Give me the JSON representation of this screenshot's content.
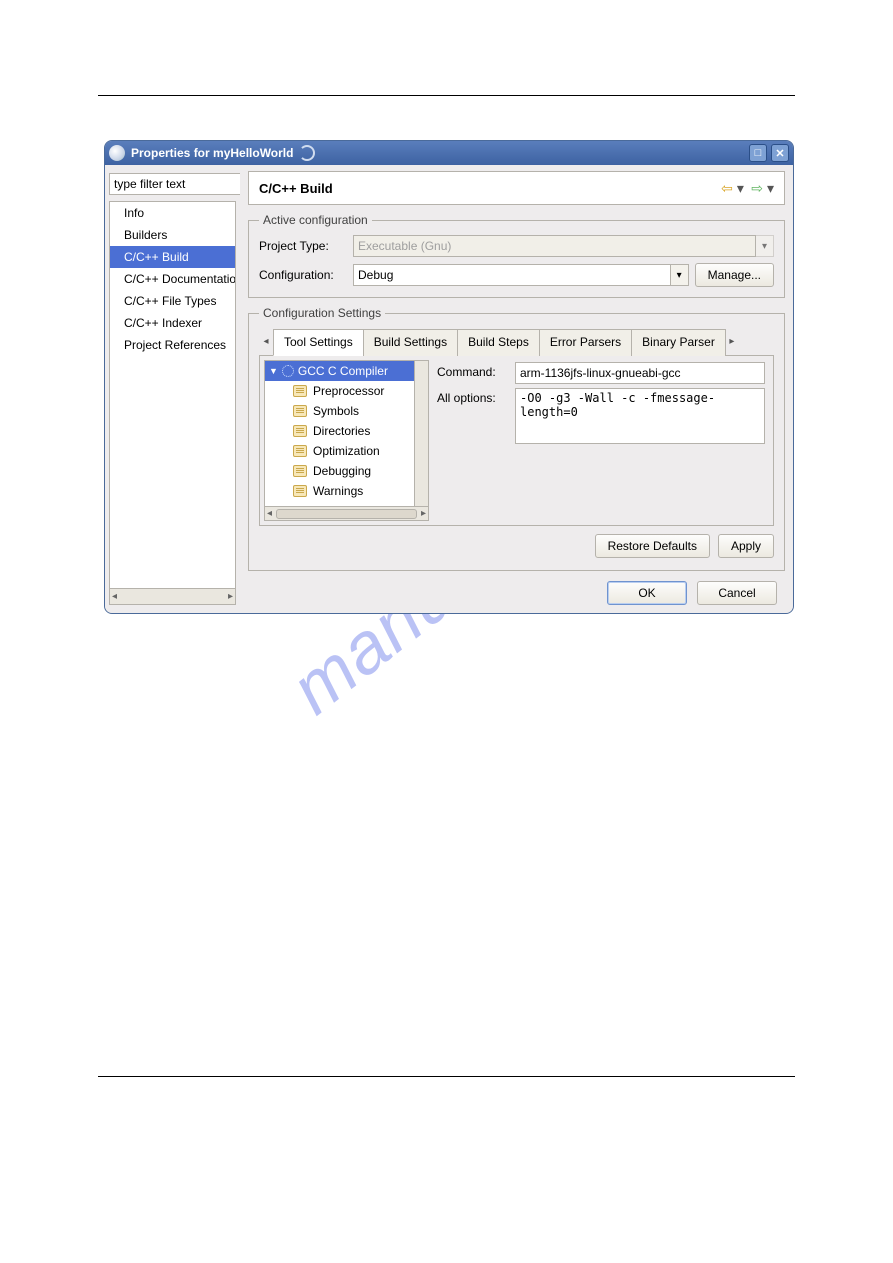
{
  "watermark": "manualshive.com",
  "titlebar": {
    "title": "Properties for myHelloWorld"
  },
  "sidebar": {
    "filter_placeholder": "type filter text",
    "items": [
      {
        "label": "Info"
      },
      {
        "label": "Builders"
      },
      {
        "label": "C/C++ Build",
        "selected": true
      },
      {
        "label": "C/C++ Documentatio"
      },
      {
        "label": "C/C++ File Types"
      },
      {
        "label": "C/C++ Indexer"
      },
      {
        "label": "Project References"
      }
    ]
  },
  "main": {
    "title": "C/C++ Build",
    "active_config": {
      "legend": "Active configuration",
      "project_type_label": "Project Type:",
      "project_type_value": "Executable (Gnu)",
      "configuration_label": "Configuration:",
      "configuration_value": "Debug",
      "manage_label": "Manage..."
    },
    "config_settings": {
      "legend": "Configuration Settings",
      "tabs": [
        "Tool Settings",
        "Build Settings",
        "Build Steps",
        "Error Parsers",
        "Binary Parser"
      ],
      "active_tab": 0,
      "tree": {
        "root": "GCC C Compiler",
        "children": [
          "Preprocessor",
          "Symbols",
          "Directories",
          "Optimization",
          "Debugging",
          "Warnings"
        ]
      },
      "form": {
        "command_label": "Command:",
        "command_value": "arm-1136jfs-linux-gnueabi-gcc",
        "all_options_label": "All options:",
        "all_options_value": "-O0 -g3 -Wall -c -fmessage-length=0"
      }
    },
    "footer": {
      "restore": "Restore Defaults",
      "apply": "Apply"
    }
  },
  "dialog_footer": {
    "ok": "OK",
    "cancel": "Cancel"
  }
}
